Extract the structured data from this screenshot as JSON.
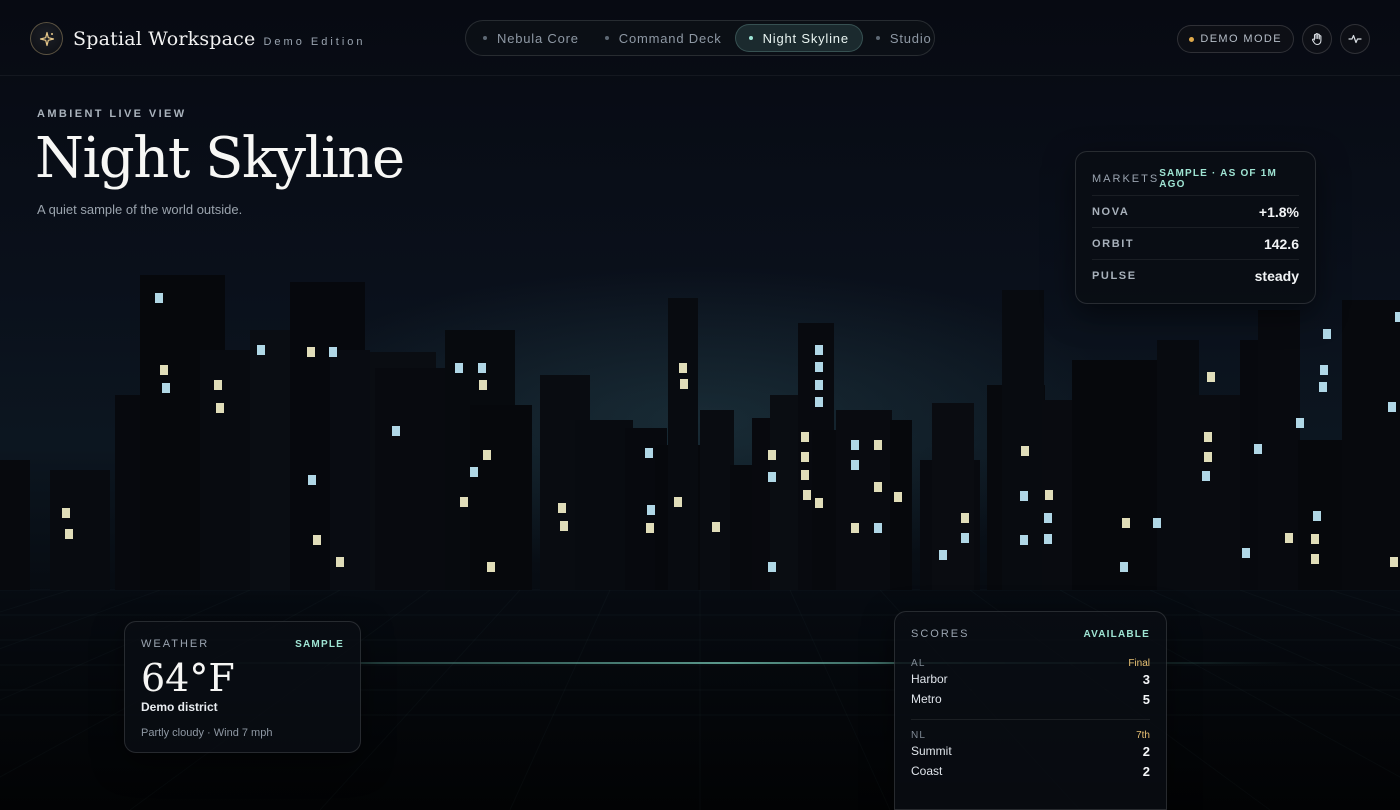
{
  "brand": {
    "title": "Spatial Workspace",
    "subtitle": "Demo Edition",
    "icon": "sparkle-icon",
    "accent": "#e8c98a"
  },
  "nav": {
    "tabs": [
      {
        "label": "Nebula Core",
        "active": false
      },
      {
        "label": "Command Deck",
        "active": false
      },
      {
        "label": "Night Skyline",
        "active": true
      },
      {
        "label": "Studio",
        "active": false
      }
    ]
  },
  "controls": {
    "demo_mode_label": "DEMO MODE",
    "hand_icon": "hand-icon",
    "pulse_icon": "activity-icon"
  },
  "hero": {
    "eyebrow": "AMBIENT LIVE VIEW",
    "title": "Night Skyline",
    "subtitle": "A quiet sample of the world outside."
  },
  "markets": {
    "label": "MARKETS",
    "tag": "SAMPLE · AS OF 1M AGO",
    "rows": [
      {
        "name": "NOVA",
        "value": "+1.8%"
      },
      {
        "name": "ORBIT",
        "value": "142.6"
      },
      {
        "name": "PULSE",
        "value": "steady"
      }
    ]
  },
  "weather": {
    "label": "WEATHER",
    "tag": "SAMPLE",
    "temperature": "64°F",
    "location": "Demo district",
    "description": "Partly cloudy · Wind 7 mph"
  },
  "scores": {
    "label": "SCORES",
    "tag": "AVAILABLE",
    "leagues": [
      {
        "name": "AL",
        "status": "Final",
        "teams": [
          {
            "name": "Harbor",
            "score": "3"
          },
          {
            "name": "Metro",
            "score": "5"
          }
        ]
      },
      {
        "name": "NL",
        "status": "7th",
        "teams": [
          {
            "name": "Summit",
            "score": "2"
          },
          {
            "name": "Coast",
            "score": "2"
          }
        ]
      }
    ]
  },
  "colors": {
    "background": "#05070d",
    "accent_teal": "#9fe4d3",
    "accent_gold": "#e6c073",
    "window_light": "#f3f0c8",
    "window_cool": "#bfe9f8"
  }
}
